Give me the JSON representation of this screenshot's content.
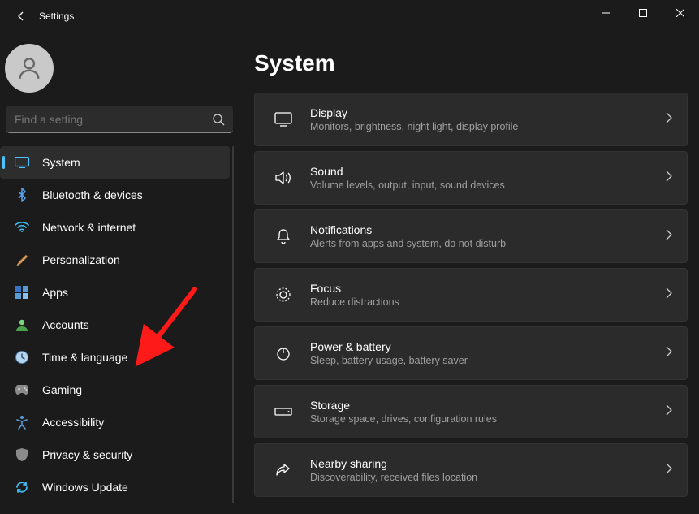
{
  "app": {
    "title": "Settings"
  },
  "search": {
    "placeholder": "Find a setting"
  },
  "nav": {
    "items": [
      {
        "label": "System"
      },
      {
        "label": "Bluetooth & devices"
      },
      {
        "label": "Network & internet"
      },
      {
        "label": "Personalization"
      },
      {
        "label": "Apps"
      },
      {
        "label": "Accounts"
      },
      {
        "label": "Time & language"
      },
      {
        "label": "Gaming"
      },
      {
        "label": "Accessibility"
      },
      {
        "label": "Privacy & security"
      },
      {
        "label": "Windows Update"
      }
    ]
  },
  "page": {
    "heading": "System",
    "cards": [
      {
        "title": "Display",
        "desc": "Monitors, brightness, night light, display profile"
      },
      {
        "title": "Sound",
        "desc": "Volume levels, output, input, sound devices"
      },
      {
        "title": "Notifications",
        "desc": "Alerts from apps and system, do not disturb"
      },
      {
        "title": "Focus",
        "desc": "Reduce distractions"
      },
      {
        "title": "Power & battery",
        "desc": "Sleep, battery usage, battery saver"
      },
      {
        "title": "Storage",
        "desc": "Storage space, drives, configuration rules"
      },
      {
        "title": "Nearby sharing",
        "desc": "Discoverability, received files location"
      }
    ]
  }
}
